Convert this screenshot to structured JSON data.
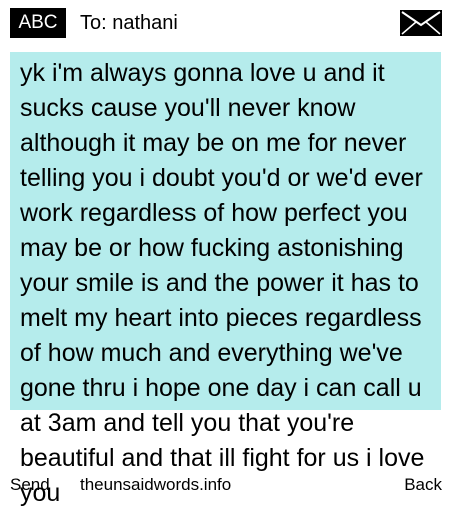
{
  "header": {
    "input_mode": "ABC",
    "to_label": "To: nathani",
    "icon": "envelope-icon"
  },
  "message": {
    "text": "yk i'm always gonna love u and it sucks cause you'll never know although it may be on me for never telling you i doubt you'd or we'd ever work regardless of how perfect you may be or how fucking astonishing your smile is and the power it has to melt my heart into pieces regardless of how much and everything we've gone thru i hope one day i can call u at 3am and tell you that you're beautiful and that ill fight for us i love you"
  },
  "softkeys": {
    "left": "Send",
    "center": "theunsaidwords.info",
    "right": "Back"
  },
  "colors": {
    "message_background": "#b5ecec",
    "input_mode_background": "#000000"
  }
}
